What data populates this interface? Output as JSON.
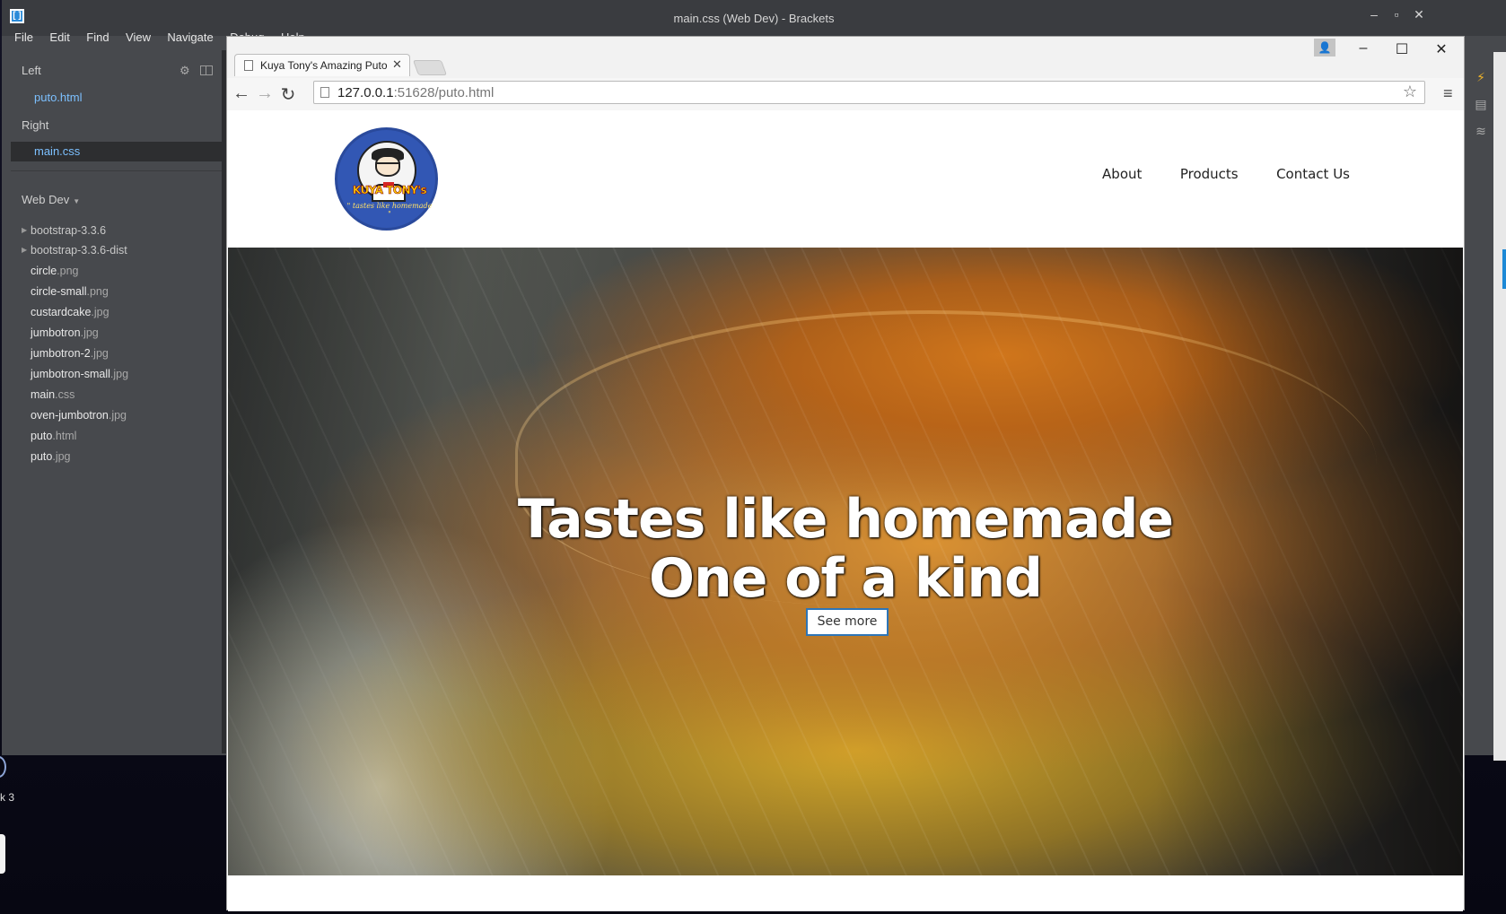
{
  "brackets": {
    "title": "main.css (Web Dev) - Brackets",
    "menu": [
      "File",
      "Edit",
      "Find",
      "View",
      "Navigate",
      "Debug",
      "Help"
    ],
    "controls": {
      "minimize": "–",
      "maximize": "▫",
      "close": "✕"
    }
  },
  "sidebar": {
    "left_heading": "Left",
    "left_file": "puto.html",
    "right_heading": "Right",
    "right_file": "main.css",
    "project": "Web Dev",
    "tree": [
      {
        "name": "bootstrap-3.3.6",
        "ext": "",
        "folder": true
      },
      {
        "name": "bootstrap-3.3.6-dist",
        "ext": "",
        "folder": true
      },
      {
        "name": "circle",
        "ext": ".png",
        "folder": false
      },
      {
        "name": "circle-small",
        "ext": ".png",
        "folder": false
      },
      {
        "name": "custardcake",
        "ext": ".jpg",
        "folder": false
      },
      {
        "name": "jumbotron",
        "ext": ".jpg",
        "folder": false
      },
      {
        "name": "jumbotron-2",
        "ext": ".jpg",
        "folder": false
      },
      {
        "name": "jumbotron-small",
        "ext": ".jpg",
        "folder": false
      },
      {
        "name": "main",
        "ext": ".css",
        "folder": false
      },
      {
        "name": "oven-jumbotron",
        "ext": ".jpg",
        "folder": false
      },
      {
        "name": "puto",
        "ext": ".html",
        "folder": false
      },
      {
        "name": "puto",
        "ext": ".jpg",
        "folder": false
      }
    ]
  },
  "desktop": {
    "label": "k 3"
  },
  "browser": {
    "tab_title": "Kuya Tony's Amazing Puto",
    "url_host": "127.0.0.1",
    "url_rest": ":51628/puto.html"
  },
  "site": {
    "logo_text": "KUYA TONY's",
    "logo_tagline": "\" tastes like homemade \"",
    "nav": [
      "About",
      "Products",
      "Contact Us"
    ],
    "hero_line1": "Tastes like homemade",
    "hero_line2": "One of a kind",
    "hero_button": "See more"
  }
}
